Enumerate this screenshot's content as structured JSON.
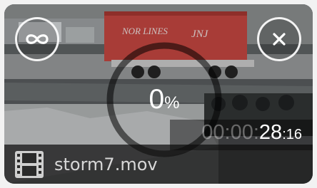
{
  "progress": {
    "percent_value": "0",
    "percent_sign": "%",
    "fraction": 0
  },
  "timer": {
    "dim": "00:00:",
    "seconds": "28",
    "frames": ":16"
  },
  "file": {
    "name": "storm7.mov",
    "icon": "film-icon"
  },
  "buttons": {
    "loop_icon": "infinity-icon",
    "close_icon": "close-icon"
  },
  "thumbnail": {
    "container_text": "NOR LINES"
  },
  "colors": {
    "container": "#c8453f",
    "overlay": "#141618",
    "text": "#ffffff"
  }
}
